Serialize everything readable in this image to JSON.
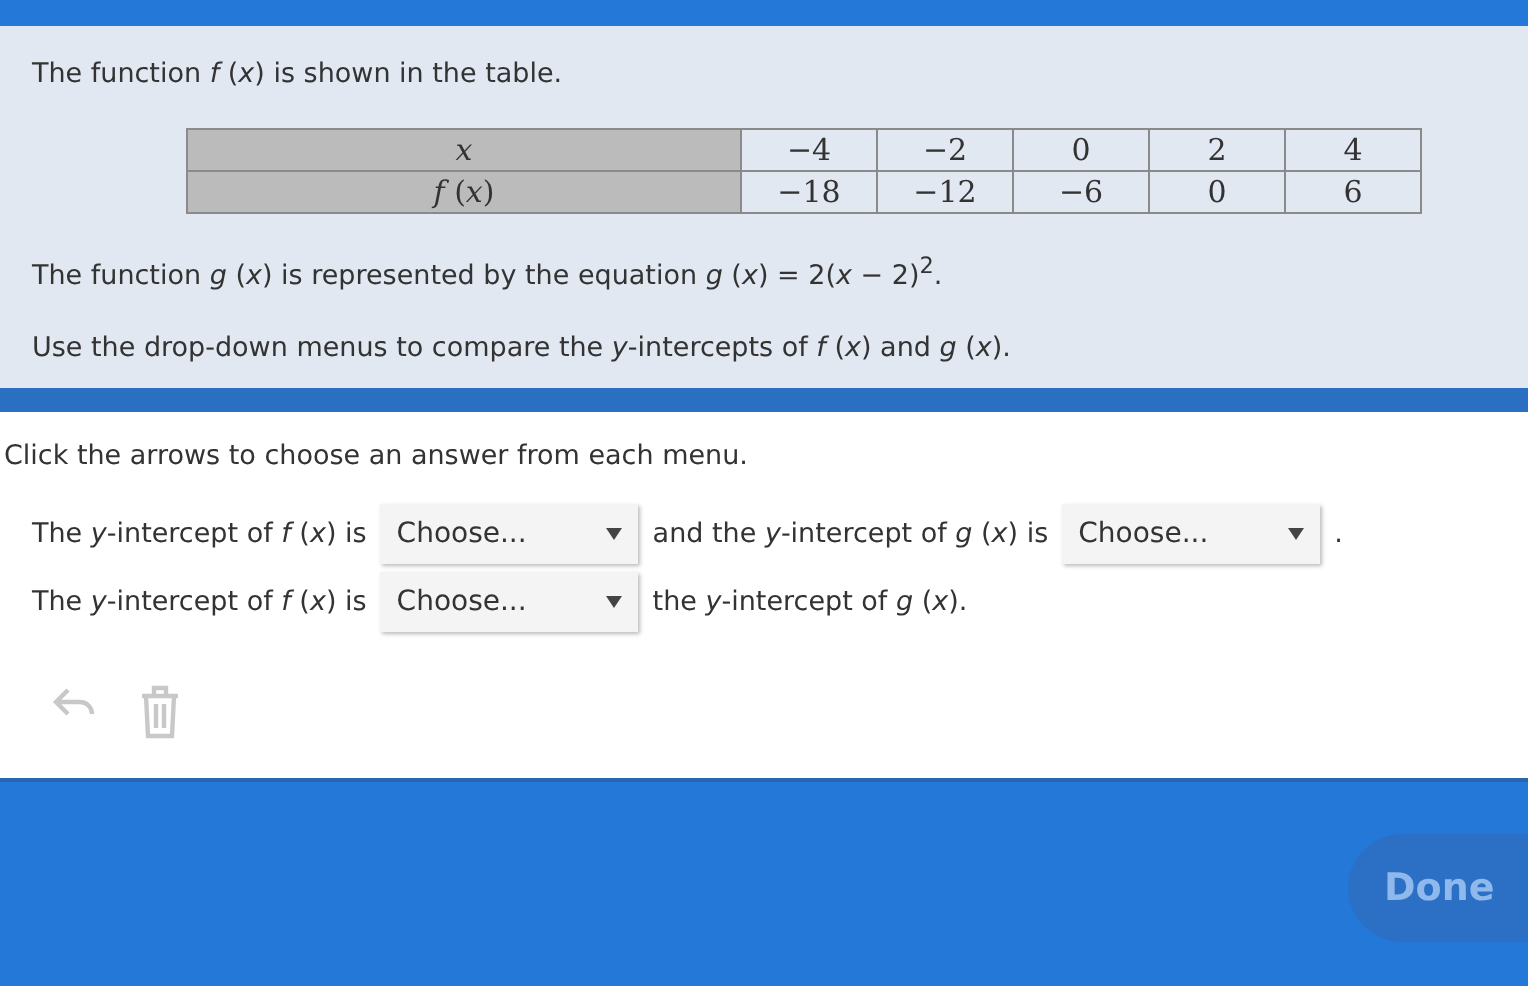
{
  "prompt": {
    "intro": "The function *f* (*x*) is shown in the table.",
    "table": {
      "rows": [
        {
          "header": "*x*",
          "cells": [
            "−4",
            "−2",
            "0",
            "2",
            "4"
          ]
        },
        {
          "header": "*f* (*x*)",
          "cells": [
            "−18",
            "−12",
            "−6",
            "0",
            "6"
          ]
        }
      ]
    },
    "equation": "The function *g* (*x*) is represented by the equation *g* (*x*) = 2(*x* − 2)$^{2}$.",
    "task": "Use the drop-down menus to compare the *y*-intercepts of *f* (*x*) and *g* (*x*)."
  },
  "instruction": "Click the arrows to choose an answer from each menu.",
  "answer_lines": [
    {
      "parts": [
        {
          "kind": "text",
          "text": "The *y*-intercept of *f* (*x*) is"
        },
        {
          "kind": "dropdown",
          "placeholder": "Choose..."
        },
        {
          "kind": "text",
          "text": "and the *y*-intercept of *g* (*x*) is"
        },
        {
          "kind": "dropdown",
          "placeholder": "Choose..."
        },
        {
          "kind": "text",
          "text": "."
        }
      ]
    },
    {
      "parts": [
        {
          "kind": "text",
          "text": "The *y*-intercept of *f* (*x*) is"
        },
        {
          "kind": "dropdown",
          "placeholder": "Choose..."
        },
        {
          "kind": "text",
          "text": "the *y*-intercept of *g* (*x*)."
        }
      ]
    }
  ],
  "tools": [
    {
      "kind": "undo",
      "disabled": true
    },
    {
      "kind": "delete",
      "disabled": true
    }
  ],
  "done_button": {
    "label": "Done",
    "disabled": true
  }
}
